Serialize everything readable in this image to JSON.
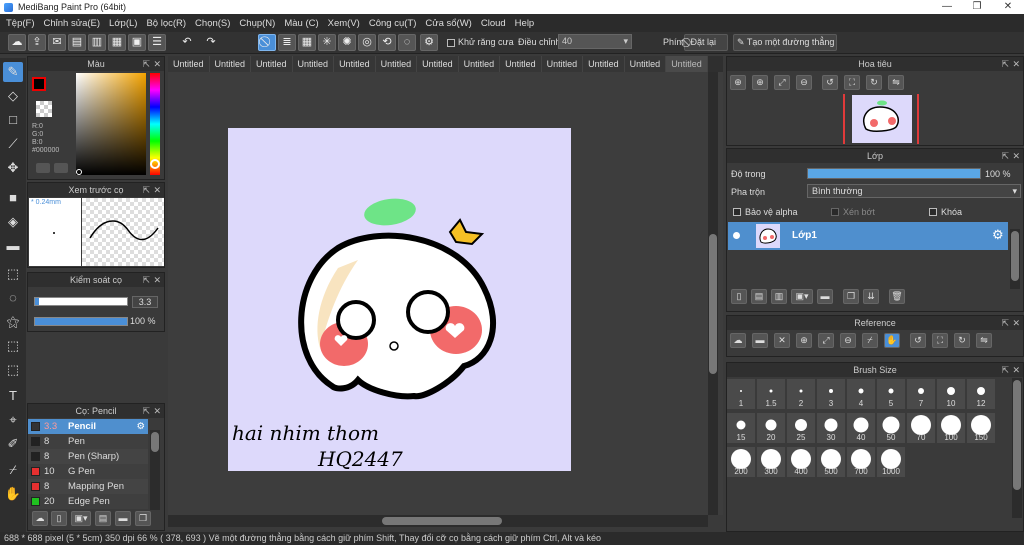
{
  "window": {
    "title": "MediBang Paint Pro (64bit)"
  },
  "menu": [
    "Tệp(F)",
    "Chỉnh sửa(E)",
    "Lớp(L)",
    "Bộ lọc(R)",
    "Chọn(S)",
    "Chụp(N)",
    "Màu (C)",
    "Xem(V)",
    "Công cụ(T)",
    "Cửa sổ(W)",
    "Cloud",
    "Help"
  ],
  "toolbar": {
    "antialias_label": "Khử răng cưa",
    "adjust_label": "Điều chỉnh",
    "adjust_value": "40",
    "pen_label": "Phím",
    "reset_label": "Đặt lại",
    "straight_label": "Tạo một đường thẳng"
  },
  "color_panel": {
    "title": "Màu",
    "r": "R:0",
    "g": "G:0",
    "b": "B:0",
    "hex": "#000000"
  },
  "preview_panel": {
    "title": "Xem trước cọ",
    "size": "0.24mm"
  },
  "control_panel": {
    "title": "Kiểm soát cọ",
    "size_value": "3.3",
    "opacity_value": "100 %"
  },
  "brush_panel": {
    "title": "Cọ: Pencil",
    "brushes": [
      {
        "size": "3.3",
        "name": "Pencil",
        "color": "#222222",
        "selected": true
      },
      {
        "size": "8",
        "name": "Pen",
        "color": "#222222"
      },
      {
        "size": "8",
        "name": "Pen (Sharp)",
        "color": "#222222"
      },
      {
        "size": "10",
        "name": "G Pen",
        "color": "#e53030"
      },
      {
        "size": "8",
        "name": "Mapping Pen",
        "color": "#e53030"
      },
      {
        "size": "20",
        "name": "Edge Pen",
        "color": "#20c020"
      }
    ]
  },
  "tabs": [
    "Untitled",
    "Untitled",
    "Untitled",
    "Untitled",
    "Untitled",
    "Untitled",
    "Untitled",
    "Untitled",
    "Untitled",
    "Untitled",
    "Untitled",
    "Untitled",
    "Untitled"
  ],
  "navigator": {
    "title": "Hoa tiêu"
  },
  "layer_panel": {
    "title": "Lớp",
    "opacity_label": "Độ trong",
    "opacity_value": "100 %",
    "opacity_fraction": 1.0,
    "blend_label": "Pha trộn",
    "blend_value": "Bình thường",
    "protect_alpha": "Bảo vệ alpha",
    "clipping": "Xén bớt",
    "lock": "Khóa",
    "layer_name": "Lớp1"
  },
  "reference": {
    "title": "Reference"
  },
  "brush_size": {
    "title": "Brush Size",
    "sizes": [
      "1",
      "1.5",
      "2",
      "3",
      "4",
      "5",
      "7",
      "10",
      "12",
      "15",
      "20",
      "25",
      "30",
      "40",
      "50",
      "70",
      "100",
      "150",
      "200",
      "300",
      "400",
      "500",
      "700",
      "1000"
    ]
  },
  "artwork": {
    "text1": "hai nhim thom",
    "text2": "HQ2447"
  },
  "status": {
    "text": "688 * 688 pixel   (5 * 5cm)   350 dpi   66 %   ( 378, 693 )   Vẽ một đường thẳng bằng cách giữ phím Shift, Thay đổi cỡ cọ bằng cách giữ phím Ctrl, Alt và kéo"
  }
}
